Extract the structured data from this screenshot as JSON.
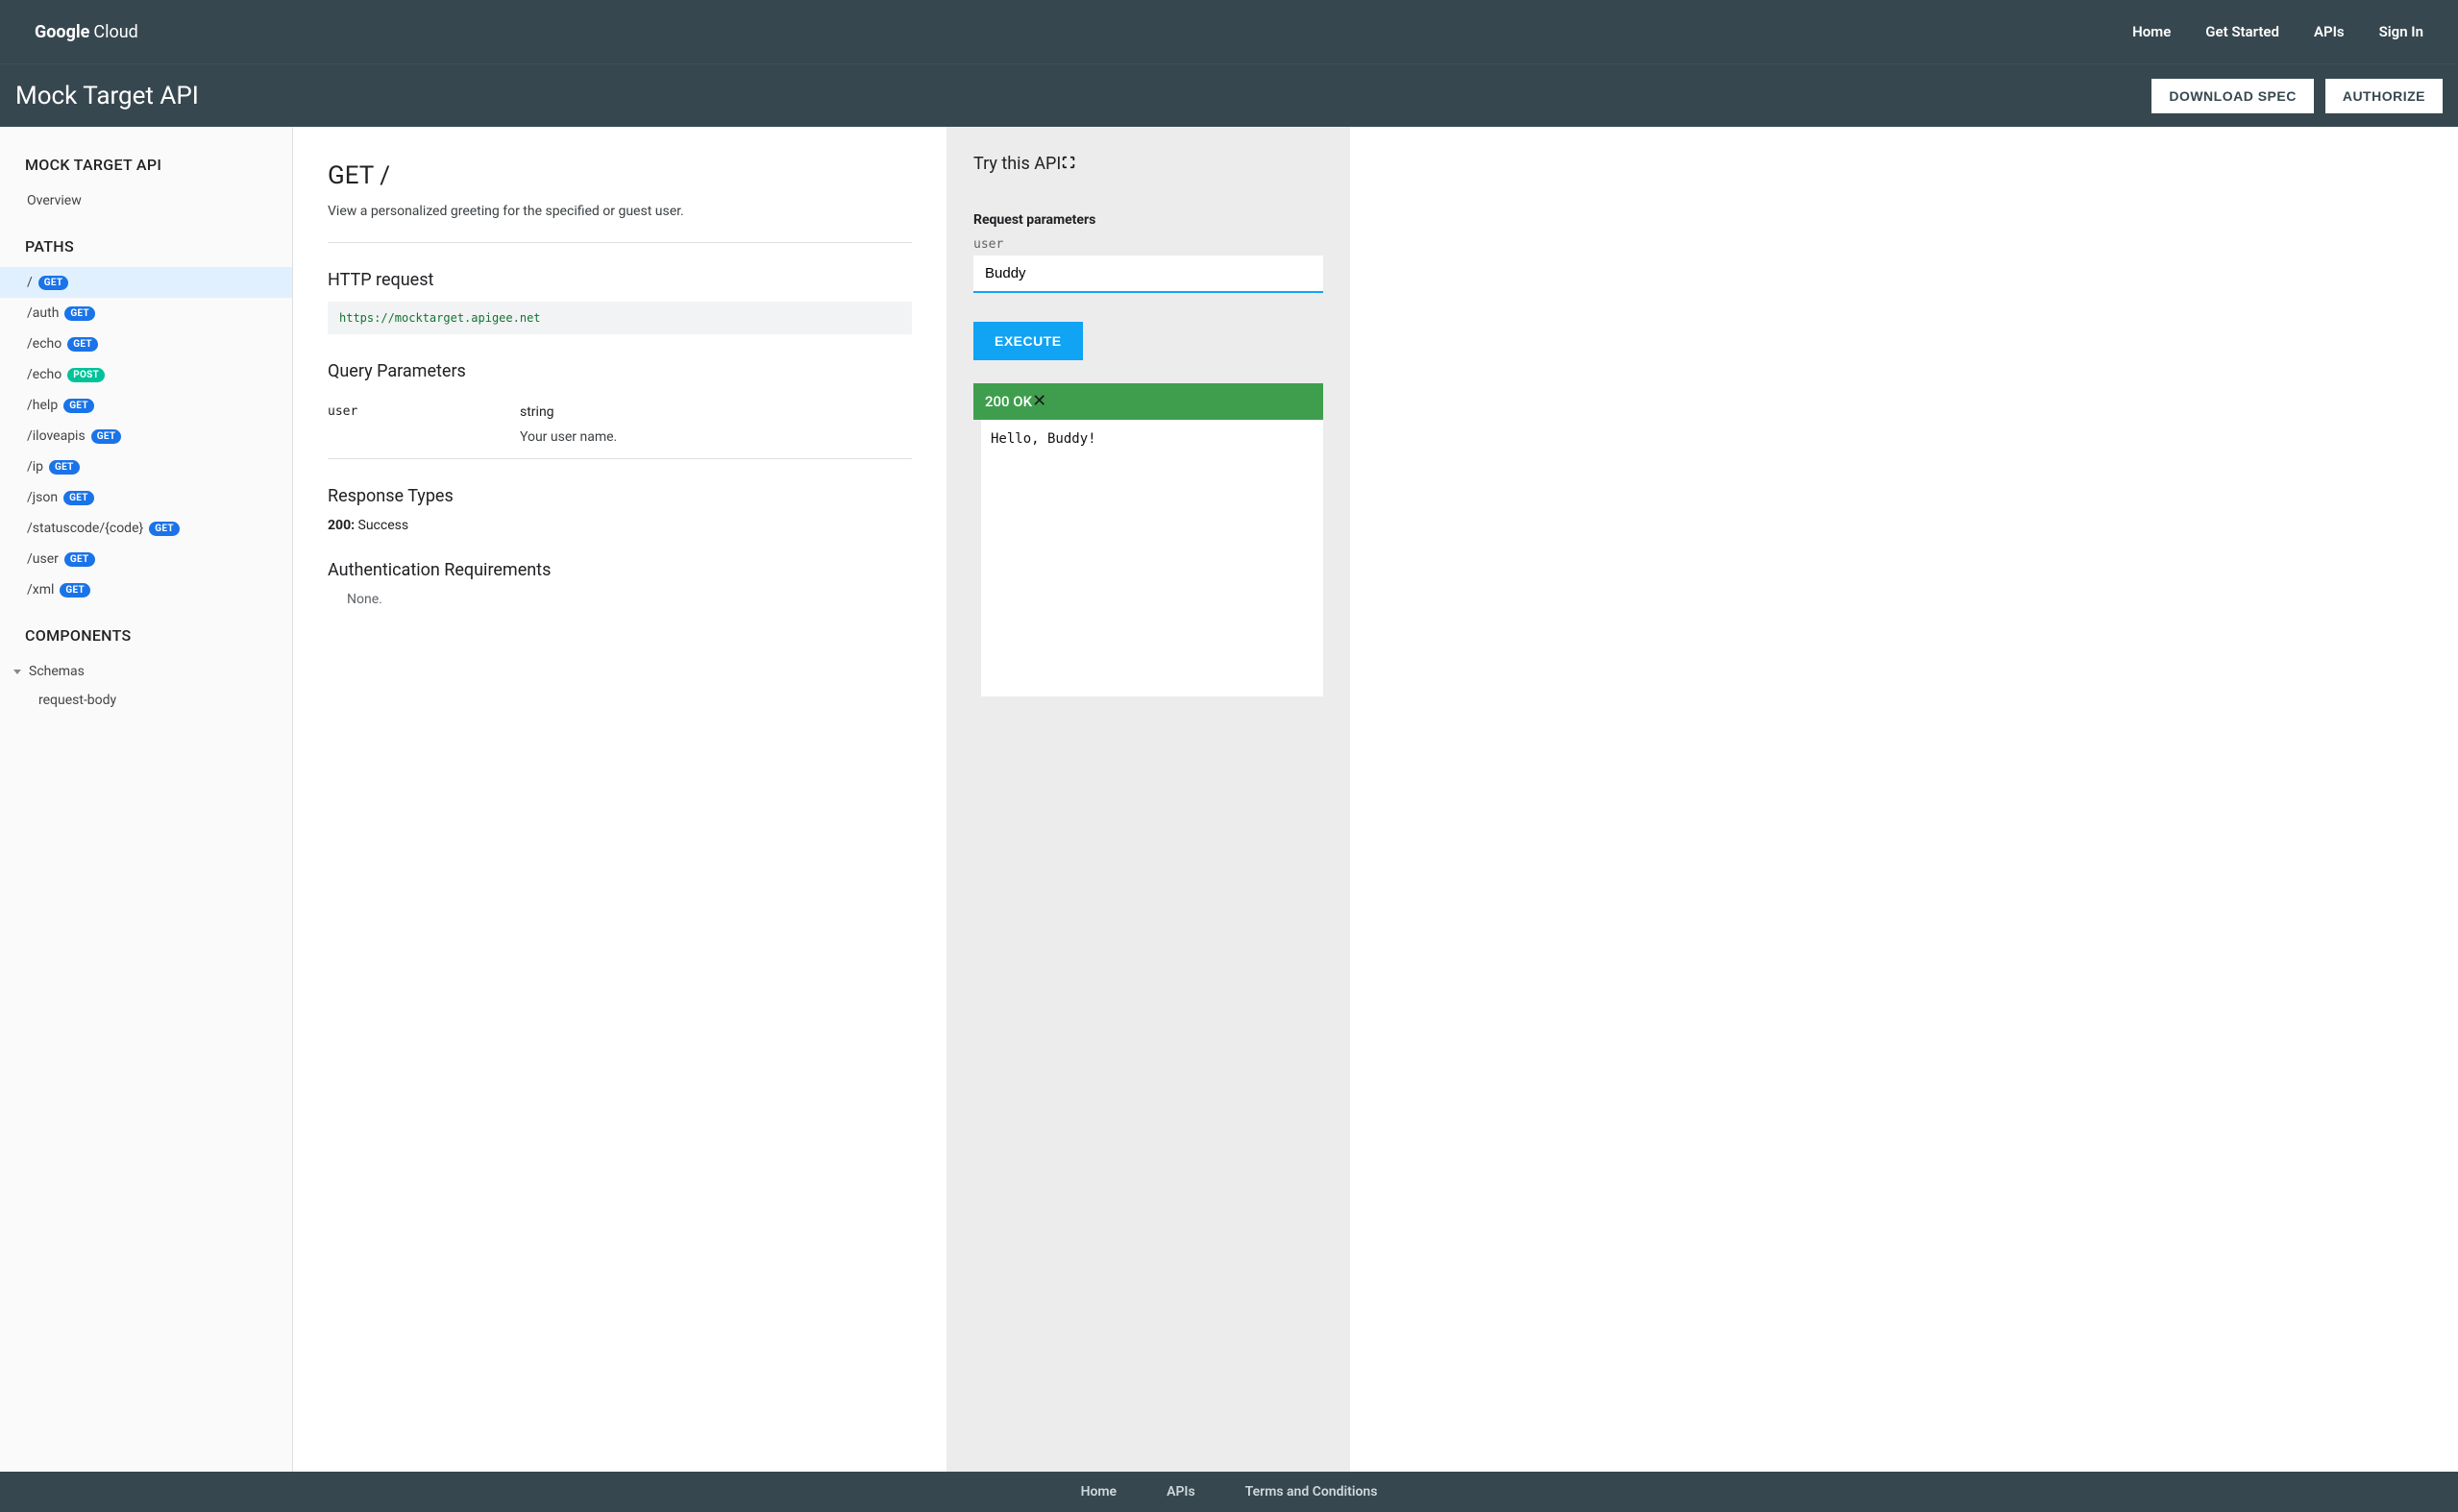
{
  "topnav": {
    "logo_bold": "Google",
    "logo_rest": "Cloud",
    "links": [
      "Home",
      "Get Started",
      "APIs",
      "Sign In"
    ]
  },
  "subhead": {
    "title": "Mock Target API",
    "download": "DOWNLOAD SPEC",
    "authorize": "AUTHORIZE"
  },
  "sidebar": {
    "api_heading": "MOCK TARGET API",
    "overview": "Overview",
    "paths_heading": "PATHS",
    "paths": [
      {
        "path": "/",
        "method": "GET",
        "active": true
      },
      {
        "path": "/auth",
        "method": "GET",
        "active": false
      },
      {
        "path": "/echo",
        "method": "GET",
        "active": false
      },
      {
        "path": "/echo",
        "method": "POST",
        "active": false
      },
      {
        "path": "/help",
        "method": "GET",
        "active": false
      },
      {
        "path": "/iloveapis",
        "method": "GET",
        "active": false
      },
      {
        "path": "/ip",
        "method": "GET",
        "active": false
      },
      {
        "path": "/json",
        "method": "GET",
        "active": false
      },
      {
        "path": "/statuscode/{code}",
        "method": "GET",
        "active": false
      },
      {
        "path": "/user",
        "method": "GET",
        "active": false
      },
      {
        "path": "/xml",
        "method": "GET",
        "active": false
      }
    ],
    "components_heading": "COMPONENTS",
    "schemas_label": "Schemas",
    "schema_item": "request-body"
  },
  "main": {
    "title": "GET /",
    "description": "View a personalized greeting for the specified or guest user.",
    "http_heading": "HTTP request",
    "http_url": "https://mocktarget.apigee.net",
    "qp_heading": "Query Parameters",
    "qp": {
      "name": "user",
      "type": "string",
      "desc": "Your user name."
    },
    "resp_heading": "Response Types",
    "resp_code": "200:",
    "resp_text": "Success",
    "auth_heading": "Authentication Requirements",
    "auth_none": "None."
  },
  "tryit": {
    "title": "Try this API",
    "req_params": "Request parameters",
    "param_name": "user",
    "param_value": "Buddy",
    "execute": "EXECUTE",
    "status": "200 OK",
    "response": "Hello, Buddy!"
  },
  "footer": {
    "links": [
      "Home",
      "APIs",
      "Terms and Conditions"
    ]
  }
}
